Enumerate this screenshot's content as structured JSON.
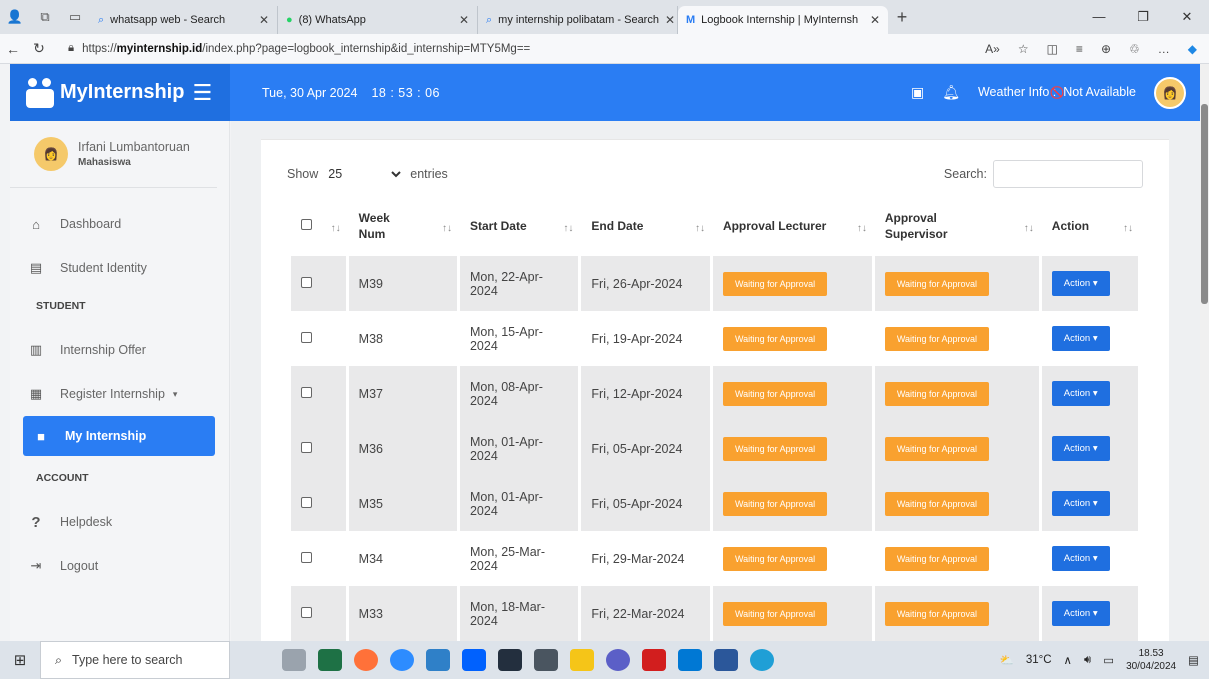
{
  "browser": {
    "tabs": [
      {
        "label": "whatsapp web - Search",
        "icon": "search-icon"
      },
      {
        "label": "(8) WhatsApp",
        "icon": "whatsapp-icon"
      },
      {
        "label": "my internship polibatam - Search",
        "icon": "search-icon"
      },
      {
        "label": "Logbook Internship | MyInternsh",
        "icon": "site-icon",
        "active": true
      }
    ],
    "url_prefix": "https://",
    "url_domain": "myinternship.id",
    "url_path": "/index.php?page=logbook_internship&id_internship=MTY5Mg=="
  },
  "topbar": {
    "brand": "MyInternship",
    "date": "Tue, 30 Apr 2024",
    "time": "18 : 53 : 06",
    "weather_label": "Weather Info :",
    "weather_value": "Not Available"
  },
  "sidebar": {
    "user_name": "Irfani Lumbantoruan",
    "user_role": "Mahasiswa",
    "items": [
      {
        "label": "Dashboard",
        "icon": "home-icon"
      },
      {
        "label": "Student Identity",
        "icon": "id-card-icon"
      }
    ],
    "student_header": "STUDENT",
    "student_items": [
      {
        "label": "Internship Offer",
        "icon": "building-icon"
      },
      {
        "label": "Register Internship",
        "icon": "form-icon"
      },
      {
        "label": "My Internship",
        "icon": "briefcase-icon"
      }
    ],
    "account_header": "ACCOUNT",
    "account_items": [
      {
        "label": "Helpdesk",
        "icon": "question-icon"
      },
      {
        "label": "Logout",
        "icon": "logout-icon"
      }
    ]
  },
  "table": {
    "show_label": "Show",
    "entries_value": "25",
    "entries_label": "entries",
    "search_label": "Search:",
    "headers": {
      "week_num": "Week Num",
      "start_date": "Start Date",
      "end_date": "End Date",
      "approval_lecturer": "Approval Lecturer",
      "approval_supervisor": "Approval Supervisor",
      "action": "Action"
    },
    "rows": [
      {
        "week": "M39",
        "start": "Mon, 22-Apr-2024",
        "end": "Fri, 26-Apr-2024",
        "lecturer": "Waiting for Approval",
        "supervisor": "Waiting for Approval",
        "action": "Action"
      },
      {
        "week": "M38",
        "start": "Mon, 15-Apr-2024",
        "end": "Fri, 19-Apr-2024",
        "lecturer": "Waiting for Approval",
        "supervisor": "Waiting for Approval",
        "action": "Action"
      },
      {
        "week": "M37",
        "start": "Mon, 08-Apr-2024",
        "end": "Fri, 12-Apr-2024",
        "lecturer": "Waiting for Approval",
        "supervisor": "Waiting for Approval",
        "action": "Action"
      },
      {
        "week": "M36",
        "start": "Mon, 01-Apr-2024",
        "end": "Fri, 05-Apr-2024",
        "lecturer": "Waiting for Approval",
        "supervisor": "Waiting for Approval",
        "action": "Action"
      },
      {
        "week": "M35",
        "start": "Mon, 01-Apr-2024",
        "end": "Fri, 05-Apr-2024",
        "lecturer": "Waiting for Approval",
        "supervisor": "Waiting for Approval",
        "action": "Action"
      },
      {
        "week": "M34",
        "start": "Mon, 25-Mar-2024",
        "end": "Fri, 29-Mar-2024",
        "lecturer": "Waiting for Approval",
        "supervisor": "Waiting for Approval",
        "action": "Action"
      },
      {
        "week": "M33",
        "start": "Mon, 18-Mar-2024",
        "end": "Fri, 22-Mar-2024",
        "lecturer": "Waiting for Approval",
        "supervisor": "Waiting for Approval",
        "action": "Action"
      }
    ]
  },
  "taskbar": {
    "search_placeholder": "Type here to search",
    "weather": "31°C",
    "time": "18.53",
    "date": "30/04/2024"
  },
  "colors": {
    "primary": "#2a7df3",
    "badge": "#f9a12f",
    "action": "#1f6fe0"
  }
}
